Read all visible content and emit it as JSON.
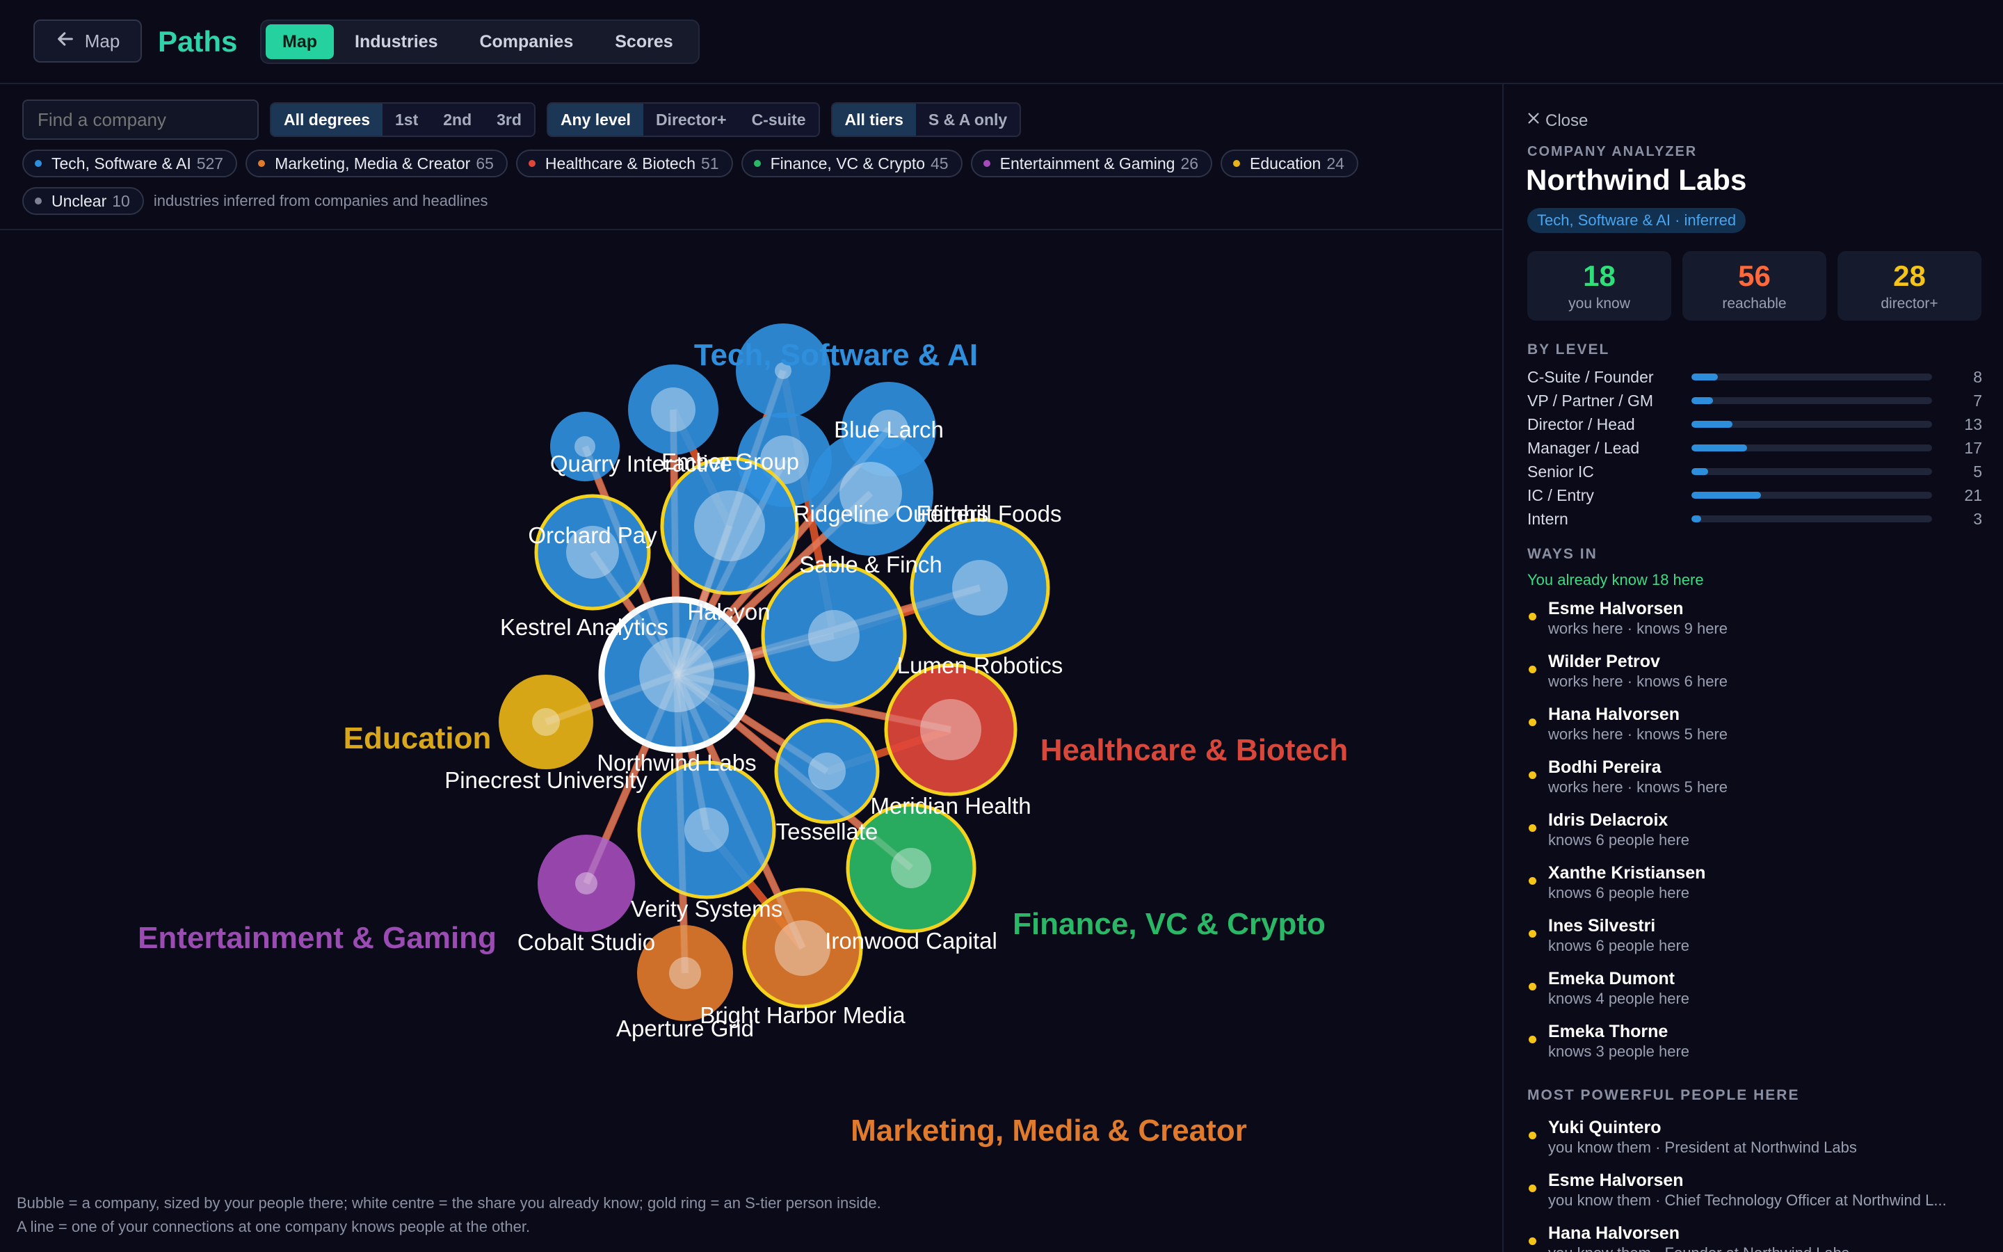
{
  "header": {
    "back_label": "Map",
    "brand": "Paths",
    "tabs": [
      {
        "label": "Map",
        "active": true
      },
      {
        "label": "Industries",
        "active": false
      },
      {
        "label": "Companies",
        "active": false
      },
      {
        "label": "Scores",
        "active": false
      }
    ]
  },
  "filters": {
    "search_placeholder": "Find a company",
    "degrees": [
      "All degrees",
      "1st",
      "2nd",
      "3rd"
    ],
    "levels": [
      "Any level",
      "Director+",
      "C-suite"
    ],
    "tiers": [
      "All tiers",
      "S & A only"
    ]
  },
  "industries": [
    {
      "name": "Tech, Software & AI",
      "count": "527",
      "color": "#2f8fdc"
    },
    {
      "name": "Marketing, Media & Creator",
      "count": "65",
      "color": "#e07a2c"
    },
    {
      "name": "Healthcare & Biotech",
      "count": "51",
      "color": "#e0463a"
    },
    {
      "name": "Finance, VC & Crypto",
      "count": "45",
      "color": "#2bb866"
    },
    {
      "name": "Entertainment & Gaming",
      "count": "26",
      "color": "#a34bb8"
    },
    {
      "name": "Education",
      "count": "24",
      "color": "#e8b417"
    },
    {
      "name": "Unclear",
      "count": "10",
      "color": "#7d8294"
    }
  ],
  "industries_note": "industries inferred from companies and headlines",
  "map": {
    "cluster_labels": [
      {
        "text": "Tech, Software & AI",
        "color": "#2f8fdc"
      },
      {
        "text": "Education",
        "color": "#d9a81a"
      },
      {
        "text": "Healthcare & Biotech",
        "color": "#d8473a"
      },
      {
        "text": "Entertainment & Gaming",
        "color": "#9a4cb3"
      },
      {
        "text": "Finance, VC & Crypto",
        "color": "#2bb866"
      },
      {
        "text": "Marketing, Media & Creator",
        "color": "#e07a2c"
      }
    ],
    "companies": [
      {
        "name": "Northwind Labs",
        "industry": "Tech, Software & AI",
        "selected": true
      },
      {
        "name": "Quarry Interactive",
        "industry": "Tech, Software & AI"
      },
      {
        "name": "Ember Group",
        "industry": "Tech, Software & AI"
      },
      {
        "name": "Blue Larch",
        "industry": "Tech, Software & AI"
      },
      {
        "name": "Ridgeline Outfitters",
        "industry": "Tech, Software & AI"
      },
      {
        "name": "Fernhill Foods",
        "industry": "Tech, Software & AI"
      },
      {
        "name": "Sable & Finch",
        "industry": "Tech, Software & AI"
      },
      {
        "name": "Kestrel Analytics",
        "industry": "Tech, Software & AI"
      },
      {
        "name": "Orchard Pay",
        "industry": "Tech, Software & AI"
      },
      {
        "name": "Lumen Robotics",
        "industry": "Tech, Software & AI"
      },
      {
        "name": "Halcyon",
        "industry": "Tech, Software & AI"
      },
      {
        "name": "Pinecrest University",
        "industry": "Education"
      },
      {
        "name": "Meridian Health",
        "industry": "Healthcare & Biotech"
      },
      {
        "name": "Tessellate",
        "industry": "Tech, Software & AI"
      },
      {
        "name": "Verity Systems",
        "industry": "Tech, Software & AI"
      },
      {
        "name": "Cobalt Studio",
        "industry": "Entertainment & Gaming"
      },
      {
        "name": "Ironwood Capital",
        "industry": "Finance, VC & Crypto"
      },
      {
        "name": "Bright Harbor Media",
        "industry": "Marketing, Media & Creator"
      },
      {
        "name": "Aperture Grid",
        "industry": "Marketing, Media & Creator"
      }
    ],
    "legend_line1": "Bubble = a company, sized by your people there; white centre = the share you already know; gold ring = an S-tier person inside.",
    "legend_line2": "A line = one of your connections at one company knows people at the other."
  },
  "analyzer": {
    "close_label": "Close",
    "kicker": "COMPANY ANALYZER",
    "company": "Northwind Labs",
    "industry_tag": "Tech, Software & AI · inferred",
    "stats": [
      {
        "value": "18",
        "label": "you know",
        "color": "#2fe07a"
      },
      {
        "value": "56",
        "label": "reachable",
        "color": "#ff6a3d"
      },
      {
        "value": "28",
        "label": "director+",
        "color": "#f4c518"
      }
    ],
    "by_level_title": "BY LEVEL",
    "levels": [
      {
        "name": "C-Suite / Founder",
        "value": "8",
        "share": 0.11
      },
      {
        "name": "VP / Partner / GM",
        "value": "7",
        "share": 0.09
      },
      {
        "name": "Director / Head",
        "value": "13",
        "share": 0.17
      },
      {
        "name": "Manager / Lead",
        "value": "17",
        "share": 0.23
      },
      {
        "name": "Senior IC",
        "value": "5",
        "share": 0.07
      },
      {
        "name": "IC / Entry",
        "value": "21",
        "share": 0.29
      },
      {
        "name": "Intern",
        "value": "3",
        "share": 0.04
      }
    ],
    "ways_in_title": "WAYS IN",
    "ways_in_note": "You already know 18 here",
    "ways_in": [
      {
        "name": "Esme Halvorsen",
        "detail": "works here · knows 9 here"
      },
      {
        "name": "Wilder Petrov",
        "detail": "works here · knows 6 here"
      },
      {
        "name": "Hana Halvorsen",
        "detail": "works here · knows 5 here"
      },
      {
        "name": "Bodhi Pereira",
        "detail": "works here · knows 5 here"
      },
      {
        "name": "Idris Delacroix",
        "detail": "knows 6 people here"
      },
      {
        "name": "Xanthe Kristiansen",
        "detail": "knows 6 people here"
      },
      {
        "name": "Ines Silvestri",
        "detail": "knows 6 people here"
      },
      {
        "name": "Emeka Dumont",
        "detail": "knows 4 people here"
      },
      {
        "name": "Emeka Thorne",
        "detail": "knows 3 people here"
      }
    ],
    "powerful_title": "MOST POWERFUL PEOPLE HERE",
    "powerful": [
      {
        "name": "Yuki Quintero",
        "detail": "you know them · President at Northwind Labs"
      },
      {
        "name": "Esme Halvorsen",
        "detail": "you know them · Chief Technology Officer at Northwind L..."
      },
      {
        "name": "Hana Halvorsen",
        "detail": "you know them · Founder at Northwind Labs"
      }
    ]
  }
}
